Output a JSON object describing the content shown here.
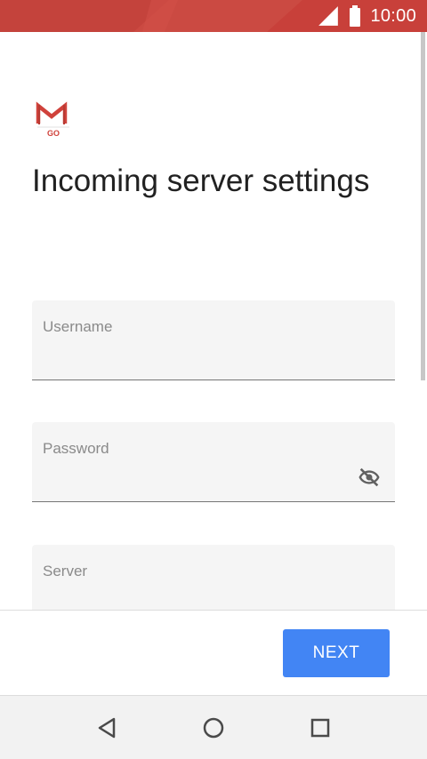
{
  "status_bar": {
    "time": "10:00",
    "icons": [
      "signal-icon",
      "battery-icon"
    ],
    "background_color": "#c8403a"
  },
  "app": {
    "logo_label": "GO",
    "logo_icon": "gmail-go-logo",
    "title": "Incoming server settings"
  },
  "form": {
    "username": {
      "label": "Username",
      "value": ""
    },
    "password": {
      "label": "Password",
      "value": "",
      "toggle_icon": "visibility-off-icon"
    },
    "server": {
      "label": "Server",
      "value": ""
    }
  },
  "actions": {
    "next_label": "NEXT",
    "accent_color": "#4285f4"
  },
  "nav_bar": {
    "icons": [
      "back-icon",
      "home-icon",
      "recents-icon"
    ]
  }
}
